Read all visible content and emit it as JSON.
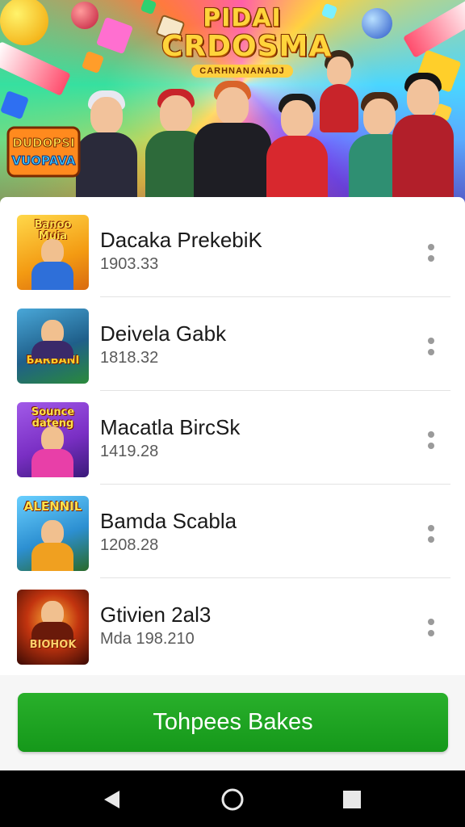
{
  "banner": {
    "title_line1": "PIDAI",
    "title_line2": "CRDOSMA",
    "subtitle": "CARHNANANADJ",
    "mini_logo_line1": "DUDOPSI",
    "mini_logo_line2": "VUOPAVA"
  },
  "apps": [
    {
      "name": "Dacaka PrekebiK",
      "meta": "1903.33",
      "thumb_title": "Banoo Muia",
      "thumb_bg": "#f7a21b",
      "accent": "#2e6fd9"
    },
    {
      "name": "Deivela Gabk",
      "meta": "1818.32",
      "thumb_title": "BARBANI",
      "thumb_bg": "#1f5f8a",
      "accent": "#c23b1e"
    },
    {
      "name": "Macatla BircSk",
      "meta": "1419.28",
      "thumb_title": "Sounce dateng",
      "thumb_bg": "#7a2fc4",
      "accent": "#e83fa8"
    },
    {
      "name": "Bamda Scabla",
      "meta": "1208.28",
      "thumb_title": "ALENNIL",
      "thumb_bg": "#2c8fd1",
      "accent": "#f0a020"
    },
    {
      "name": "Gtivien 2al3",
      "meta": "Mda 198.210",
      "thumb_title": "BIOHOK",
      "thumb_bg": "#8a1c0c",
      "accent": "#ff9d2a"
    }
  ],
  "cta_label": "Tohpees Bakes",
  "colors": {
    "cta": "#1fa224",
    "navbar": "#000000"
  },
  "nav": {
    "back_icon": "back-triangle-icon",
    "home_icon": "home-circle-icon",
    "recent_icon": "recents-square-icon"
  }
}
